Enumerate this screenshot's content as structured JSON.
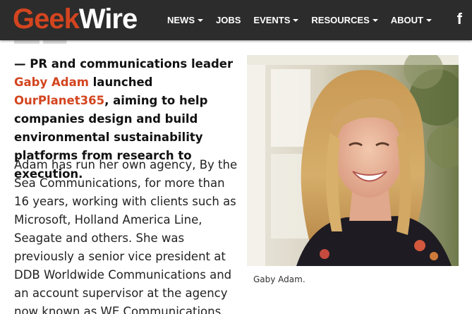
{
  "header": {
    "logo": {
      "part1": "Geek",
      "part2": "Wire"
    },
    "nav": [
      {
        "label": "NEWS",
        "dropdown": true
      },
      {
        "label": "JOBS",
        "dropdown": false
      },
      {
        "label": "EVENTS",
        "dropdown": true
      },
      {
        "label": "RESOURCES",
        "dropdown": true
      },
      {
        "label": "ABOUT",
        "dropdown": true
      }
    ],
    "facebook_icon": "f"
  },
  "article": {
    "lead": {
      "prefix": "— PR and communications leader ",
      "person_link": "Gaby Adam",
      "middle": " launched ",
      "company_link": "OurPlanet365",
      "suffix": ", aiming to help companies design and build environmental sustainability platforms from research to execution."
    },
    "paragraph": "Adam has run her own agency, By the Sea Communications, for more than 16 years, working with clients such as Microsoft, Holland America Line, Seagate and others. She was previously a senior vice president at DDB Worldwide Communications and an account supervisor at the agency now known as WE Communications.",
    "photo_caption": "Gaby Adam."
  },
  "colors": {
    "brand_orange": "#d3451f",
    "header_bg": "#2c2c2c"
  }
}
